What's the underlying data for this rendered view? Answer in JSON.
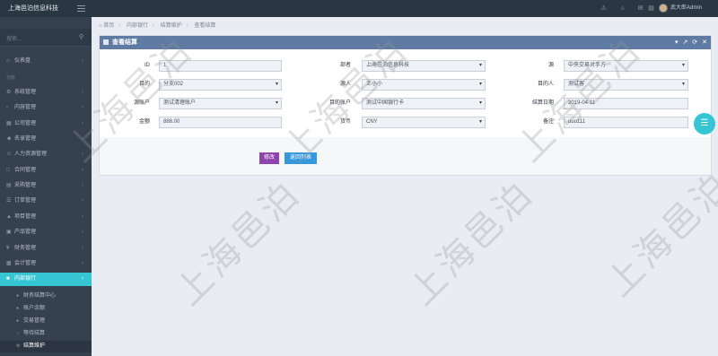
{
  "topbar": {
    "brand": "上海邑泊信息科技",
    "user": "武大郎Admin",
    "icons": [
      "bell-icon",
      "home-icon",
      "inbox-icon",
      "calendar-icon"
    ]
  },
  "sidebar": {
    "search_placeholder": "搜索...",
    "section_label": "功能",
    "items": [
      {
        "label": "仪表盘",
        "icon": "dashboard-icon"
      },
      {
        "label": "系统管理",
        "icon": "gear-icon"
      },
      {
        "label": "内容管理",
        "icon": "file-icon"
      },
      {
        "label": "公司管理",
        "icon": "building-icon"
      },
      {
        "label": "名录管理",
        "icon": "user-icon"
      },
      {
        "label": "人力资源管理",
        "icon": "people-icon"
      },
      {
        "label": "合同管理",
        "icon": "doc-icon"
      },
      {
        "label": "采购管理",
        "icon": "cart-icon"
      },
      {
        "label": "订单管理",
        "icon": "order-icon"
      },
      {
        "label": "项目管理",
        "icon": "project-icon"
      },
      {
        "label": "产品管理",
        "icon": "box-icon"
      },
      {
        "label": "财务管理",
        "icon": "money-icon"
      },
      {
        "label": "会计管理",
        "icon": "calc-icon"
      },
      {
        "label": "内部银行",
        "icon": "bank-icon"
      }
    ],
    "sub_items": [
      {
        "label": "财务结算中心",
        "icon": "dot-icon"
      },
      {
        "label": "账户余额",
        "icon": "dot-icon"
      },
      {
        "label": "交易管理",
        "icon": "dot-icon"
      },
      {
        "label": "等待结算",
        "icon": "dot-icon"
      },
      {
        "label": "结算维护",
        "icon": "dot-icon"
      }
    ]
  },
  "breadcrumb": [
    "首页",
    "内部银行",
    "结算维护",
    "查看结算"
  ],
  "portlet": {
    "title": "查看结算",
    "tools": [
      "▾",
      "↗",
      "⟳",
      "✕"
    ]
  },
  "form": {
    "fields": [
      {
        "label": "ID",
        "value": "1",
        "type": "text"
      },
      {
        "label": "部者",
        "value": "上海邑泊信息科技",
        "type": "select"
      },
      {
        "label": "源",
        "value": "中央交易对手方",
        "type": "select"
      },
      {
        "label": "目的",
        "value": "分支002",
        "type": "select"
      },
      {
        "label": "源人",
        "value": "王小小",
        "type": "select"
      },
      {
        "label": "目的人",
        "value": "测试客",
        "type": "select"
      },
      {
        "label": "源账户",
        "value": "测试清理账户",
        "type": "select"
      },
      {
        "label": "目的账户",
        "value": "测试中国银行卡",
        "type": "select"
      },
      {
        "label": "结算日期",
        "value": "2019-04-11",
        "type": "text"
      },
      {
        "label": "金额",
        "value": "888.00",
        "type": "text"
      },
      {
        "label": "货币",
        "value": "CNY",
        "type": "select"
      },
      {
        "label": "备注",
        "value": "uuu111",
        "type": "text"
      }
    ],
    "edit_label": "修改",
    "back_label": "返回列表"
  },
  "watermark": "上海邑泊"
}
